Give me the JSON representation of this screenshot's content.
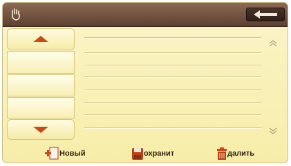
{
  "toolbar": {
    "hand_icon": "hand-icon",
    "back_icon": "back-arrow-icon"
  },
  "list_controls": {
    "up_icon": "triangle-up-icon",
    "down_icon": "triangle-down-icon"
  },
  "scroll": {
    "up_icon": "double-chevron-up-icon",
    "down_icon": "double-chevron-down-icon"
  },
  "actions": {
    "new_label": "Новый",
    "save_label": "охранит",
    "delete_label": "далить"
  },
  "colors": {
    "accent": "#c94a18",
    "titlebar": "#5c4030",
    "background": "#f7eda9"
  }
}
